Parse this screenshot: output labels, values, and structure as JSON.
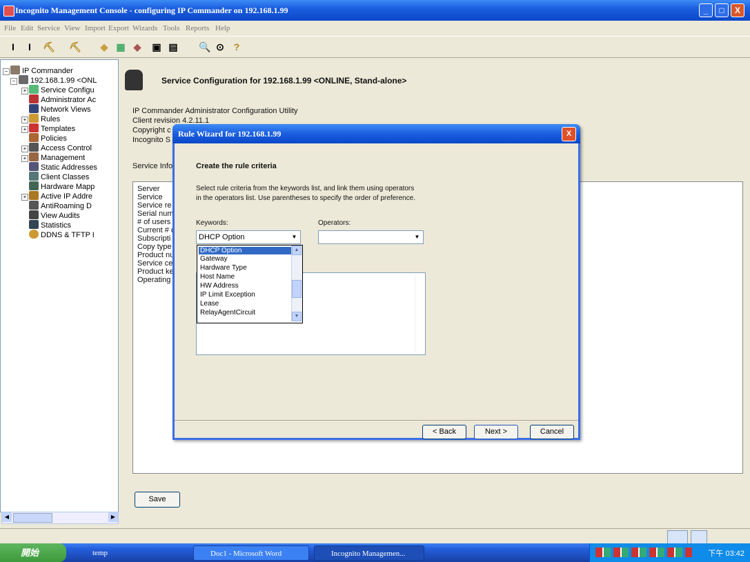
{
  "window": {
    "title": "Incognito Management Console - configuring IP Commander on 192.168.1.99",
    "controls": {
      "minimize": "_",
      "maximize": "□",
      "close": "X"
    }
  },
  "menu": [
    "File",
    "Edit",
    "Service",
    "View",
    "Import",
    "Export",
    "Wizards",
    "Tools",
    "Reports",
    "Help"
  ],
  "toolbar": [
    "I",
    "I",
    "⛏",
    "⛏",
    "◆",
    "▦",
    "◆",
    "▣",
    "▤",
    "🔍",
    "⊙",
    "?"
  ],
  "tree": {
    "root": "IP Commander",
    "server": "192.168.1.99 <ONL",
    "items": [
      "Service Configu",
      "Administrator Ac",
      "Network Views",
      "Rules",
      "Templates",
      "Policies",
      "Access Control",
      "Management",
      "Static Addresses",
      "Client Classes",
      "Hardware Mapp",
      "Active IP Addre",
      "AntiRoaming D",
      "View Audits",
      "Statistics",
      "DDNS & TFTP I"
    ]
  },
  "main": {
    "heading": "Service Configuration for 192.168.1.99 <ONLINE, Stand-alone>",
    "info_lines": [
      "IP Commander Administrator Configuration Utility",
      "Client revision 4.2.11.1",
      "Copyright c",
      "Incognito S"
    ],
    "service_info_label": "Service Info",
    "fields": [
      "Server",
      "Service",
      "Service re",
      "Serial num",
      "# of users",
      "Current # c",
      "Subscripti",
      "Copy type",
      "Product nu",
      "Service ce",
      "Product ke",
      "Operating"
    ],
    "save_label": "Save"
  },
  "dialog": {
    "title": "Rule Wizard for 192.168.1.99",
    "close": "X",
    "heading": "Create the rule criteria",
    "instructions_1": "Select rule criteria from the keywords list, and link them using operators",
    "instructions_2": "in the operators list. Use parentheses to specify the order of preference.",
    "keywords_label": "Keywords:",
    "operators_label": "Operators:",
    "keyword_selected": "DHCP Option",
    "operator_selected": "",
    "keyword_options": [
      "DHCP Option",
      "Gateway",
      "Hardware Type",
      "Host Name",
      "HW Address",
      "IP Limit Exception",
      "Lease",
      "RelayAgentCircuit"
    ],
    "back_label": "< Back",
    "next_label": "Next >",
    "cancel_label": "Cancel"
  },
  "taskbar": {
    "start": "開始",
    "tasks": [
      "temp",
      "Doc1 - Microsoft Word",
      "Incognito Managemen..."
    ],
    "clock": "下午 03:42"
  }
}
